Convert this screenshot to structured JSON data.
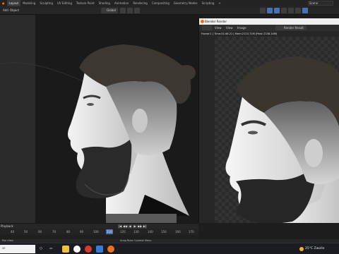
{
  "topbar": {
    "workspaces": [
      "Layout",
      "Modeling",
      "Sculpting",
      "UV Editing",
      "Texture Paint",
      "Shading",
      "Animation",
      "Rendering",
      "Compositing",
      "Geometry Nodes",
      "Scripting"
    ],
    "active_workspace": "Layout",
    "add_tab": "+",
    "scene": "Scene"
  },
  "viewport_header": {
    "menu_add": "Add",
    "menu_object": "Object",
    "orientation": "Global"
  },
  "render_window": {
    "title": "Blender Render",
    "menu": [
      "View",
      "View",
      "Image"
    ],
    "image_name": "Render Result",
    "info": "Frame:1 | Time:01:46.21 | Mem:2113.71M (Peak 2138.14M)"
  },
  "timeline": {
    "label": "Playback",
    "ruler": [
      "40",
      "50",
      "60",
      "70",
      "80",
      "90",
      "100",
      "110",
      "120",
      "130",
      "140",
      "150",
      "160",
      "170"
    ],
    "current_frame": "110",
    "playback_icons": [
      "|◀",
      "◀◀",
      "◀",
      "▶",
      "▶▶",
      "▶|"
    ]
  },
  "status": {
    "left": "Pan View",
    "middle": "Snap Ruler Context Menu"
  },
  "taskbar": {
    "search_placeholder": "Type here to search",
    "search_visible": "ar",
    "weather": "25°C Zwolle",
    "sun_color": "#f5b221"
  },
  "colors": {
    "blender_orange": "#e8731a",
    "active_blue": "#4a72b0"
  }
}
